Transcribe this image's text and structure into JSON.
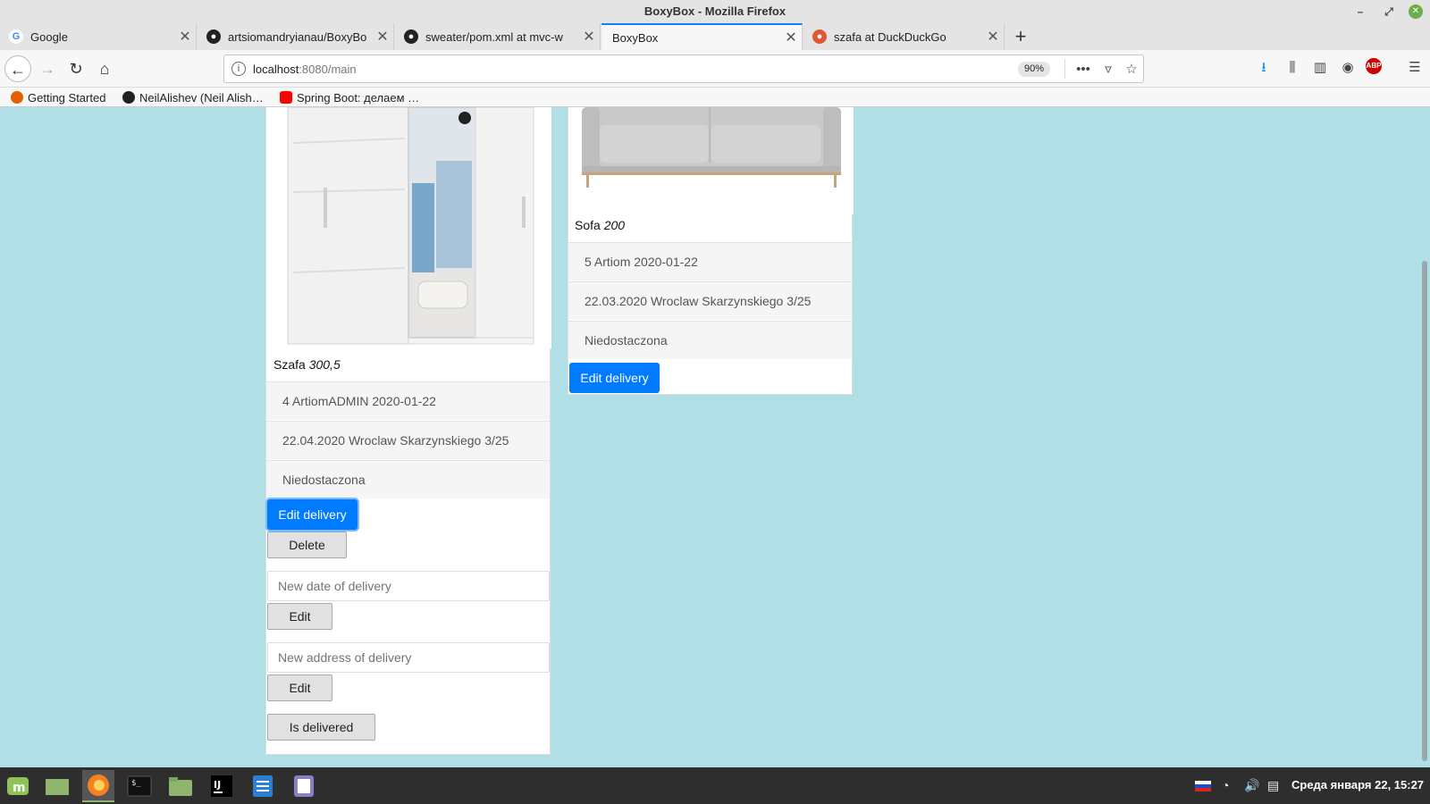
{
  "window": {
    "title": "BoxyBox - Mozilla Firefox"
  },
  "tabs": [
    {
      "title": "Google",
      "icon": "google-icon"
    },
    {
      "title": "artsiomandryianau/BoxyBo",
      "icon": "github-icon"
    },
    {
      "title": "sweater/pom.xml at mvc-w",
      "icon": "github-icon"
    },
    {
      "title": "BoxyBox",
      "icon": ""
    },
    {
      "title": "szafa at DuckDuckGo",
      "icon": "duckduckgo-icon"
    }
  ],
  "nav": {
    "url_host": "localhost",
    "url_rest": ":8080/main",
    "zoom": "90%"
  },
  "bookmarks": [
    {
      "label": "Getting Started",
      "icon": "firefox-icon"
    },
    {
      "label": "NeilAlishev (Neil Alish…",
      "icon": "github-icon"
    },
    {
      "label": "Spring Boot: делаем …",
      "icon": "youtube-icon"
    }
  ],
  "cards": [
    {
      "name": "Szafa",
      "price": "300,5",
      "items": [
        "4 ArtiomADMIN 2020-01-22",
        "22.04.2020 Wroclaw Skarzynskiego 3/25",
        "Niedostaczona"
      ],
      "edit_delivery_label": "Edit delivery",
      "delete_label": "Delete",
      "date_placeholder": "New date of delivery",
      "edit_label": "Edit",
      "address_placeholder": "New address of delivery",
      "is_delivered_label": "Is delivered"
    },
    {
      "name": "Sofa",
      "price": "200",
      "items": [
        "5 Artiom 2020-01-22",
        "22.03.2020 Wroclaw Skarzynskiego 3/25",
        "Niedostaczona"
      ],
      "edit_delivery_label": "Edit delivery"
    }
  ],
  "taskbar": {
    "clock": "Среда января 22, 15:27",
    "apps": [
      "mint-menu-icon",
      "show-desktop-icon",
      "firefox-icon",
      "terminal-icon",
      "files-icon",
      "intellij-icon",
      "writer-icon",
      "text-editor-icon"
    ]
  }
}
